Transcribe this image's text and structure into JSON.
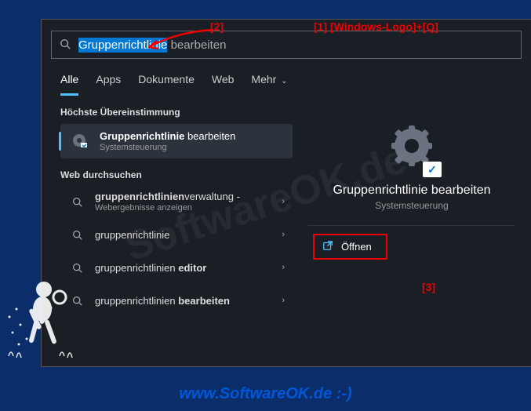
{
  "annotations": {
    "a1": "[1]  [Windows-Logo]+[Q]",
    "a2": "[2]",
    "a3": "[3]"
  },
  "search": {
    "highlighted": "Gruppenrichtlinie",
    "rest": " bearbeiten"
  },
  "tabs": {
    "all": "Alle",
    "apps": "Apps",
    "docs": "Dokumente",
    "web": "Web",
    "more": "Mehr"
  },
  "sections": {
    "best": "Höchste Übereinstimmung",
    "web": "Web durchsuchen"
  },
  "bestMatch": {
    "titleBold": "Gruppenrichtlinie",
    "titleRest": " bearbeiten",
    "sub": "Systemsteuerung"
  },
  "webResults": [
    {
      "titleBold": "gruppenrichtlinien",
      "titleRest": "verwaltung",
      "suffix": " -",
      "sub": "Webergebnisse anzeigen"
    },
    {
      "titleBold": "",
      "titleRest": "gruppenrichtlinie",
      "suffix": "",
      "sub": ""
    },
    {
      "titleBold": " editor",
      "titleRest": "gruppenrichtlinien",
      "suffix": "",
      "sub": ""
    },
    {
      "titleBold": " bearbeiten",
      "titleRest": "gruppenrichtlinien",
      "suffix": "",
      "sub": ""
    }
  ],
  "detail": {
    "title": "Gruppenrichtlinie bearbeiten",
    "sub": "Systemsteuerung",
    "open": "Öffnen"
  },
  "footer": "www.SoftwareOK.de :-)",
  "watermark": "SoftwareOK.de"
}
